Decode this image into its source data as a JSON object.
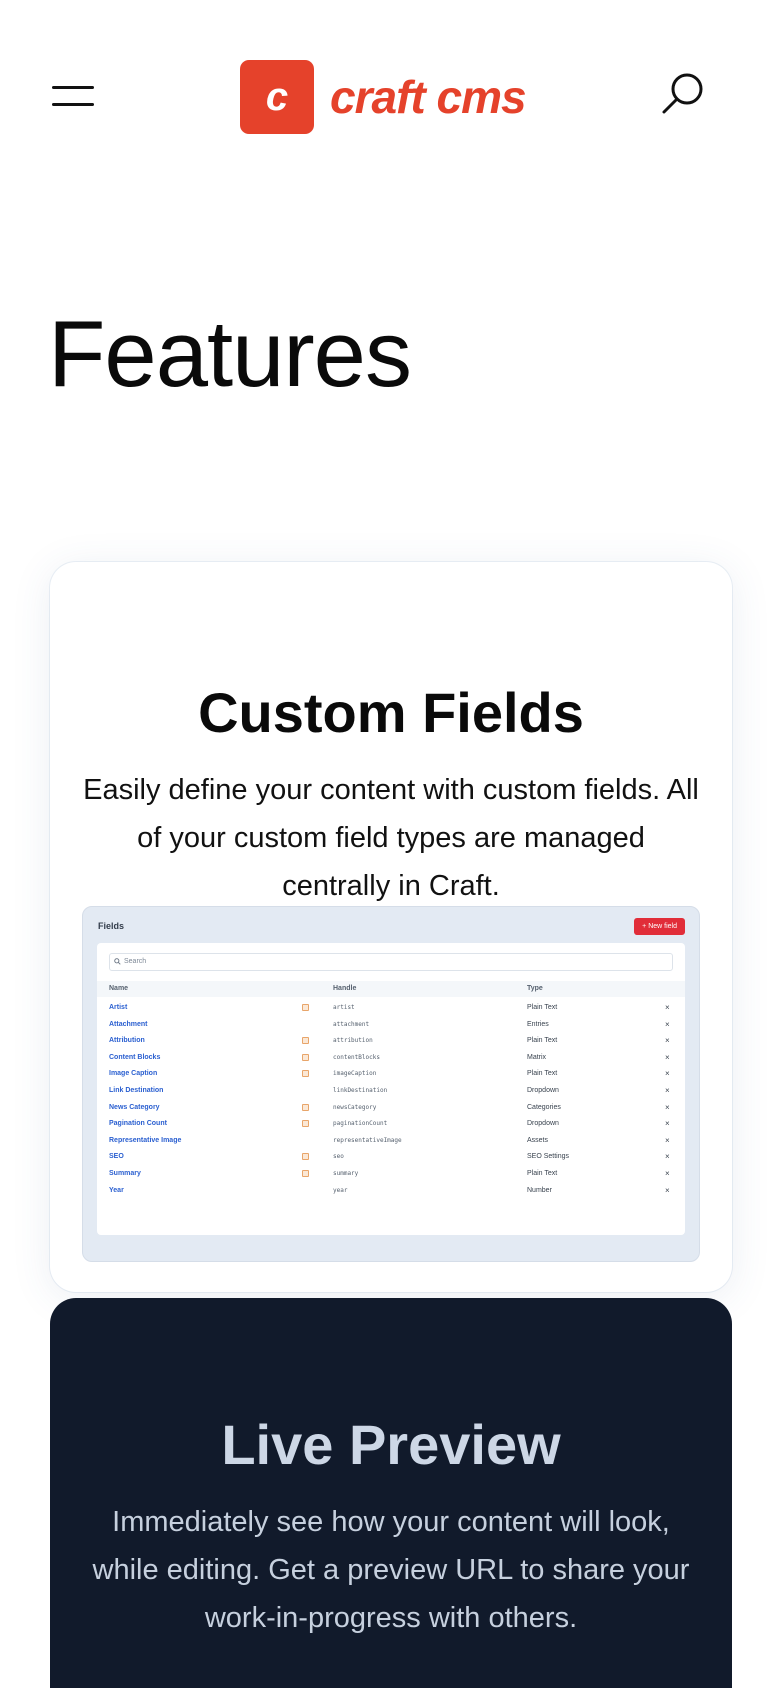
{
  "header": {
    "logo_mark": "c",
    "logo_text": "craft cms"
  },
  "page": {
    "title": "Features"
  },
  "custom_fields": {
    "title": "Custom Fields",
    "description": "Easily define your content with custom fields. All of your custom field types are managed centrally in Craft.",
    "screenshot": {
      "title": "Fields",
      "new_button": "+ New field",
      "search_placeholder": "Search",
      "columns": [
        "Name",
        "Handle",
        "Type"
      ],
      "rows": [
        {
          "name": "Artist",
          "handle": "artist",
          "type": "Plain Text",
          "translatable": true
        },
        {
          "name": "Attachment",
          "handle": "attachment",
          "type": "Entries",
          "translatable": false
        },
        {
          "name": "Attribution",
          "handle": "attribution",
          "type": "Plain Text",
          "translatable": true
        },
        {
          "name": "Content Blocks",
          "handle": "contentBlocks",
          "type": "Matrix",
          "translatable": true
        },
        {
          "name": "Image Caption",
          "handle": "imageCaption",
          "type": "Plain Text",
          "translatable": true
        },
        {
          "name": "Link Destination",
          "handle": "linkDestination",
          "type": "Dropdown",
          "translatable": false
        },
        {
          "name": "News Category",
          "handle": "newsCategory",
          "type": "Categories",
          "translatable": true
        },
        {
          "name": "Pagination Count",
          "handle": "paginationCount",
          "type": "Dropdown",
          "translatable": true
        },
        {
          "name": "Representative Image",
          "handle": "representativeImage",
          "type": "Assets",
          "translatable": false
        },
        {
          "name": "SEO",
          "handle": "seo",
          "type": "SEO Settings",
          "translatable": true
        },
        {
          "name": "Summary",
          "handle": "summary",
          "type": "Plain Text",
          "translatable": true
        },
        {
          "name": "Year",
          "handle": "year",
          "type": "Number",
          "translatable": false
        }
      ]
    }
  },
  "live_preview": {
    "title": "Live Preview",
    "description": "Immediately see how your content will look, while editing. Get a preview URL to share your work-in-progress with others."
  },
  "colors": {
    "brand": "#e5422b",
    "dark_card": "#111a2b",
    "link_blue": "#2a5fd0"
  },
  "icons": {
    "menu": "hamburger-menu-icon",
    "search": "search-icon"
  }
}
